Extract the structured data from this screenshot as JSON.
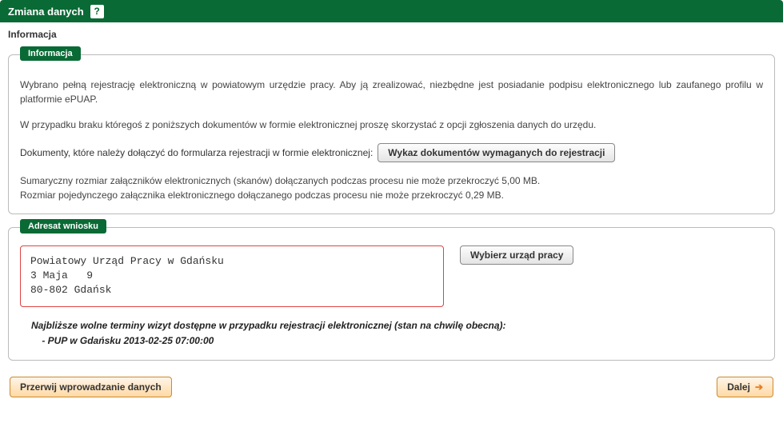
{
  "header": {
    "title": "Zmiana danych",
    "help": "?"
  },
  "section_label": "Informacja",
  "info_panel": {
    "legend": "Informacja",
    "p1": "Wybrano pełną rejestrację elektroniczną w powiatowym urzędzie pracy. Aby ją zrealizować, niezbędne jest posiadanie podpisu elektronicznego lub zaufanego profilu w platformie ePUAP.",
    "p2": "W przypadku braku któregoś z poniższych dokumentów w formie elektronicznej proszę skorzystać z opcji zgłoszenia danych do urzędu.",
    "docs_label": "Dokumenty, które należy dołączyć do formularza rejestracji w formie elektronicznej:",
    "docs_button": "Wykaz dokumentów wymaganych do rejestracji",
    "size1": "Sumaryczny rozmiar załączników elektronicznych (skanów) dołączanych podczas procesu nie może przekroczyć 5,00 MB.",
    "size2": "Rozmiar pojedynczego załącznika elektronicznego dołączanego podczas procesu nie może przekroczyć 0,29 MB."
  },
  "addr_panel": {
    "legend": "Adresat wniosku",
    "address": "Powiatowy Urząd Pracy w Gdańsku\n3 Maja   9\n80-802 Gdańsk",
    "select_button": "Wybierz urząd pracy"
  },
  "notice": {
    "line1": "Najbliższe wolne terminy wizyt dostępne w przypadku rejestracji elektronicznej (stan na chwilę obecną):",
    "line2": "    - PUP w Gdańsku 2013-02-25 07:00:00"
  },
  "footer": {
    "cancel": "Przerwij wprowadzanie danych",
    "next": "Dalej"
  }
}
